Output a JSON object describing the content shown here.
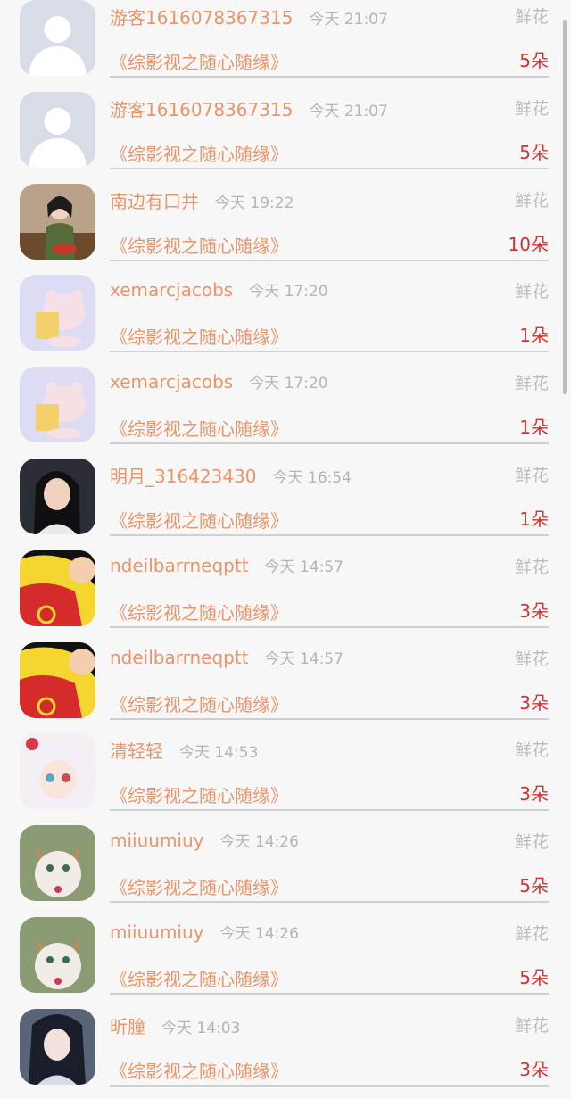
{
  "gift_list": [
    {
      "name": "游客1616078367315",
      "time": "今天 21:07",
      "gift": "鲜花",
      "work": "《综影视之随心随缘》",
      "count": "5朵",
      "avatar": "default-user-avatar"
    },
    {
      "name": "游客1616078367315",
      "time": "今天 21:07",
      "gift": "鲜花",
      "work": "《综影视之随心随缘》",
      "count": "5朵",
      "avatar": "default-user-avatar"
    },
    {
      "name": "南边有口井",
      "time": "今天 19:22",
      "gift": "鲜花",
      "work": "《综影视之随心随缘》",
      "count": "10朵",
      "avatar": "photo-avatar"
    },
    {
      "name": "xemarcjacobs",
      "time": "今天 17:20",
      "gift": "鲜花",
      "work": "《综影视之随心随缘》",
      "count": "1朵",
      "avatar": "cartoon-pig-avatar"
    },
    {
      "name": "xemarcjacobs",
      "time": "今天 17:20",
      "gift": "鲜花",
      "work": "《综影视之随心随缘》",
      "count": "1朵",
      "avatar": "cartoon-pig-avatar"
    },
    {
      "name": "明月_316423430",
      "time": "今天 16:54",
      "gift": "鲜花",
      "work": "《综影视之随心随缘》",
      "count": "1朵",
      "avatar": "photo-avatar"
    },
    {
      "name": "ndeilbarrneqptt",
      "time": "今天 14:57",
      "gift": "鲜花",
      "work": "《综影视之随心随缘》",
      "count": "3朵",
      "avatar": "cartoon-boy-avatar"
    },
    {
      "name": "ndeilbarrneqptt",
      "time": "今天 14:57",
      "gift": "鲜花",
      "work": "《综影视之随心随缘》",
      "count": "3朵",
      "avatar": "cartoon-boy-avatar"
    },
    {
      "name": "清轻轻",
      "time": "今天 14:53",
      "gift": "鲜花",
      "work": "《综影视之随心随缘》",
      "count": "3朵",
      "avatar": "anime-girl-avatar"
    },
    {
      "name": "miiuumiuy",
      "time": "今天 14:26",
      "gift": "鲜花",
      "work": "《综影视之随心随缘》",
      "count": "5朵",
      "avatar": "cat-avatar"
    },
    {
      "name": "miiuumiuy",
      "time": "今天 14:26",
      "gift": "鲜花",
      "work": "《综影视之随心随缘》",
      "count": "5朵",
      "avatar": "cat-avatar"
    },
    {
      "name": "昕膧",
      "time": "今天 14:03",
      "gift": "鲜花",
      "work": "《综影视之随心随缘》",
      "count": "3朵",
      "avatar": "anime-girl-avatar"
    }
  ],
  "colors": {
    "name": "#e8956a",
    "time": "#b4b4b4",
    "gift": "#bdbdbd",
    "count": "#d23232",
    "background": "#f7f7f7"
  }
}
